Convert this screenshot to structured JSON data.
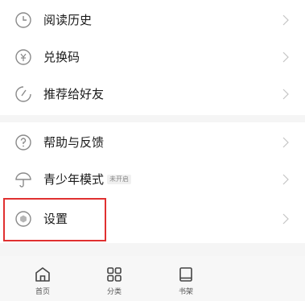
{
  "menu": {
    "group1": [
      {
        "label": "阅读历史",
        "icon": "clock-icon"
      },
      {
        "label": "兑换码",
        "icon": "coupon-icon"
      },
      {
        "label": "推荐给好友",
        "icon": "share-icon"
      }
    ],
    "group2": [
      {
        "label": "帮助与反馈",
        "icon": "help-icon"
      },
      {
        "label": "青少年模式",
        "icon": "umbrella-icon",
        "badge": "未开启"
      },
      {
        "label": "设置",
        "icon": "settings-icon"
      }
    ]
  },
  "tabbar": {
    "items": [
      {
        "label": "首页",
        "icon": "home-icon"
      },
      {
        "label": "分类",
        "icon": "grid-icon"
      },
      {
        "label": "书架",
        "icon": "bookshelf-icon"
      }
    ]
  },
  "colors": {
    "highlight": "#e03030",
    "icon": "#8a8a8a",
    "tab_icon": "#444444",
    "background": "#f5f5f5"
  }
}
